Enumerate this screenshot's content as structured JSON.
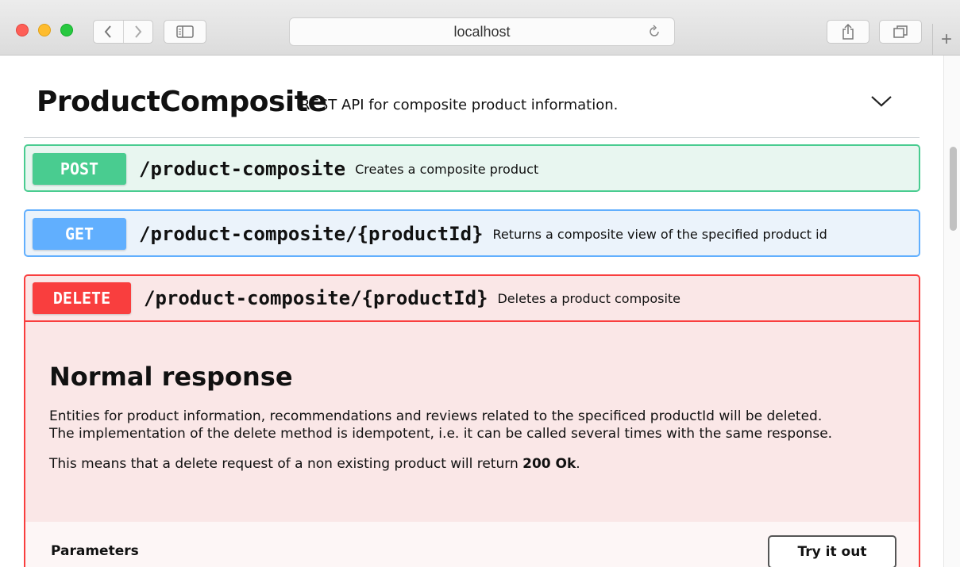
{
  "browser": {
    "address": "localhost"
  },
  "tag": {
    "title": "ProductComposite",
    "description": "REST API for composite product information."
  },
  "operations": [
    {
      "method": "POST",
      "path": "/product-composite",
      "summary": "Creates a composite product",
      "color": "#49cc90"
    },
    {
      "method": "GET",
      "path": "/product-composite/{productId}",
      "summary": "Returns a composite view of the specified product id",
      "color": "#61affe"
    },
    {
      "method": "DELETE",
      "path": "/product-composite/{productId}",
      "summary": "Deletes a product composite",
      "color": "#f93e3e"
    }
  ],
  "delete_details": {
    "heading": "Normal response",
    "paragraph1_line1": "Entities for product information, recommendations and reviews related to the specificed productId will be deleted.",
    "paragraph1_line2": "The implementation of the delete method is idempotent, i.e. it can be called several times with the same response.",
    "paragraph2_prefix": "This means that a delete request of a non existing product will return ",
    "paragraph2_bold": "200 Ok",
    "paragraph2_suffix": ".",
    "parameters_label": "Parameters",
    "try_button": "Try it out"
  },
  "icons": {
    "back": "chevron-left-icon",
    "forward": "chevron-right-icon",
    "sidebar": "sidebar-icon",
    "reload": "reload-icon",
    "share": "share-icon",
    "tabs": "tabs-icon",
    "new_tab": "plus-icon",
    "collapse": "chevron-down-icon"
  }
}
